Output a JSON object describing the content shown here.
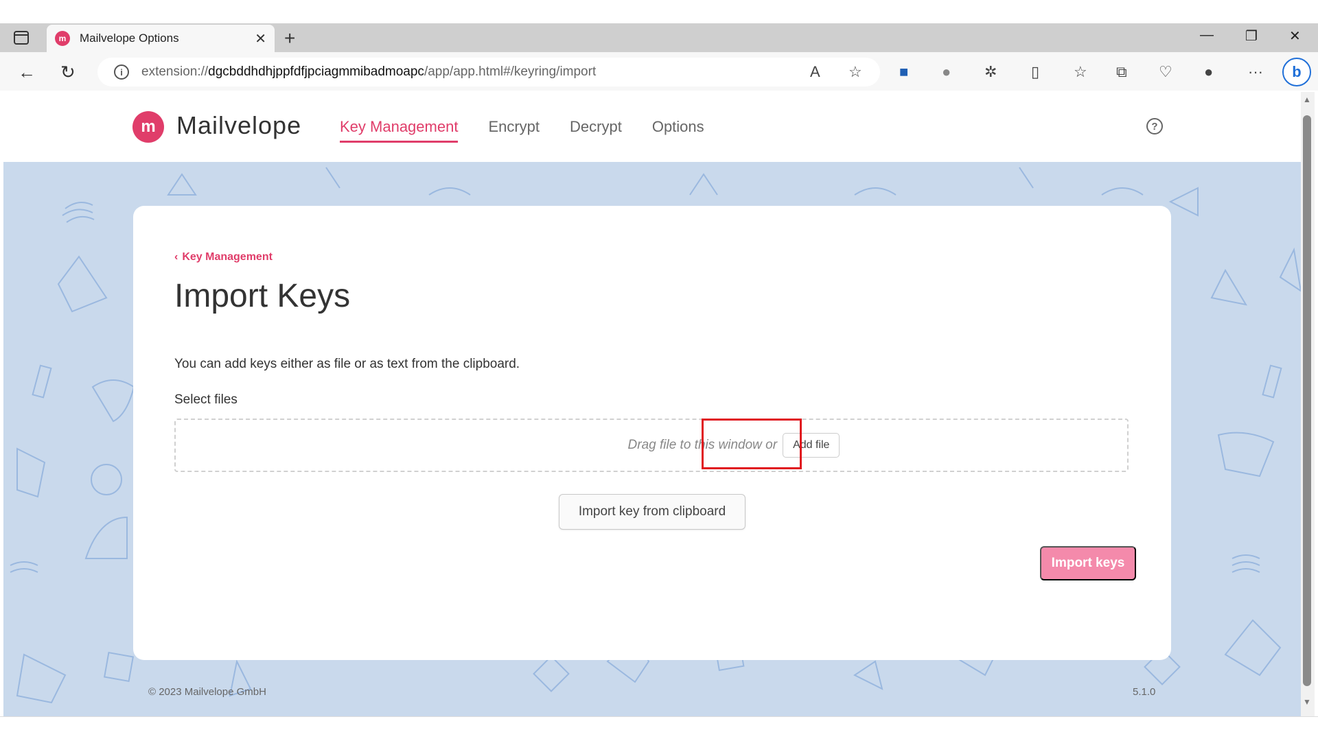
{
  "browser": {
    "tab_title": "Mailvelope Options",
    "tab_favicon": "m",
    "url_prefix": "extension://",
    "url_host": "dgcbddhdhjppfdfjpciagmmibadmoapc",
    "url_path": "/app/app.html#/keyring/import",
    "bing_label": "b"
  },
  "header": {
    "logo_mark": "m",
    "logo_text": "Mailvelope",
    "nav": [
      "Key Management",
      "Encrypt",
      "Decrypt",
      "Options"
    ],
    "active_nav": "Key Management",
    "help_icon": "?"
  },
  "card": {
    "back_label": "Key Management",
    "title": "Import Keys",
    "intro": "You can add keys either as file or as text from the clipboard.",
    "select_label": "Select files",
    "drop_hint": "Drag file to this window or",
    "add_file_label": "Add file",
    "clipboard_label": "Import key from clipboard",
    "import_label": "Import keys"
  },
  "footer": {
    "copyright": "© 2023  Mailvelope GmbH",
    "version": "5.1.0"
  },
  "colors": {
    "accent": "#e03d6a",
    "import_button_disabled": "#f48aab",
    "page_background": "#c9d9ec",
    "highlight": "#e0161e"
  }
}
